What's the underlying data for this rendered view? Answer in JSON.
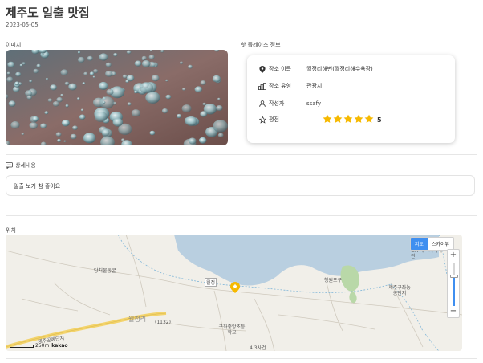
{
  "post": {
    "title": "제주도 일출 맛집",
    "date": "2023-05-05"
  },
  "sections": {
    "image": "이미지",
    "hotplace": "핫 플레이스 정보",
    "detail": "상세내용",
    "location": "위치"
  },
  "info": {
    "place_name_label": "장소 이름",
    "place_name": "월정리해변(월정리해수욕장)",
    "place_type_label": "장소 유형",
    "place_type": "관광지",
    "author_label": "작성자",
    "author": "ssafy",
    "rating_label": "평점",
    "rating": 5,
    "rating_text": "5"
  },
  "detail_text": "일출 보기 참 좋아요",
  "map": {
    "type_map": "지도",
    "type_skyview": "스카이뷰",
    "zoom_in": "+",
    "zoom_out": "−",
    "scale_label": "250m",
    "provider": "kakao",
    "labels": [
      "당처물동굴",
      "월정리",
      "(1132)",
      "구좌중앙초등학교",
      "4.3사건",
      "제주공예단지",
      "제주구좌농공단지",
      "CFI 에너지미래관",
      "행원포구",
      "월정"
    ]
  },
  "colors": {
    "accent": "#3f8ff0",
    "star": "#f6b900",
    "sea": "#b9cfe0",
    "road": "#f3d36b"
  }
}
